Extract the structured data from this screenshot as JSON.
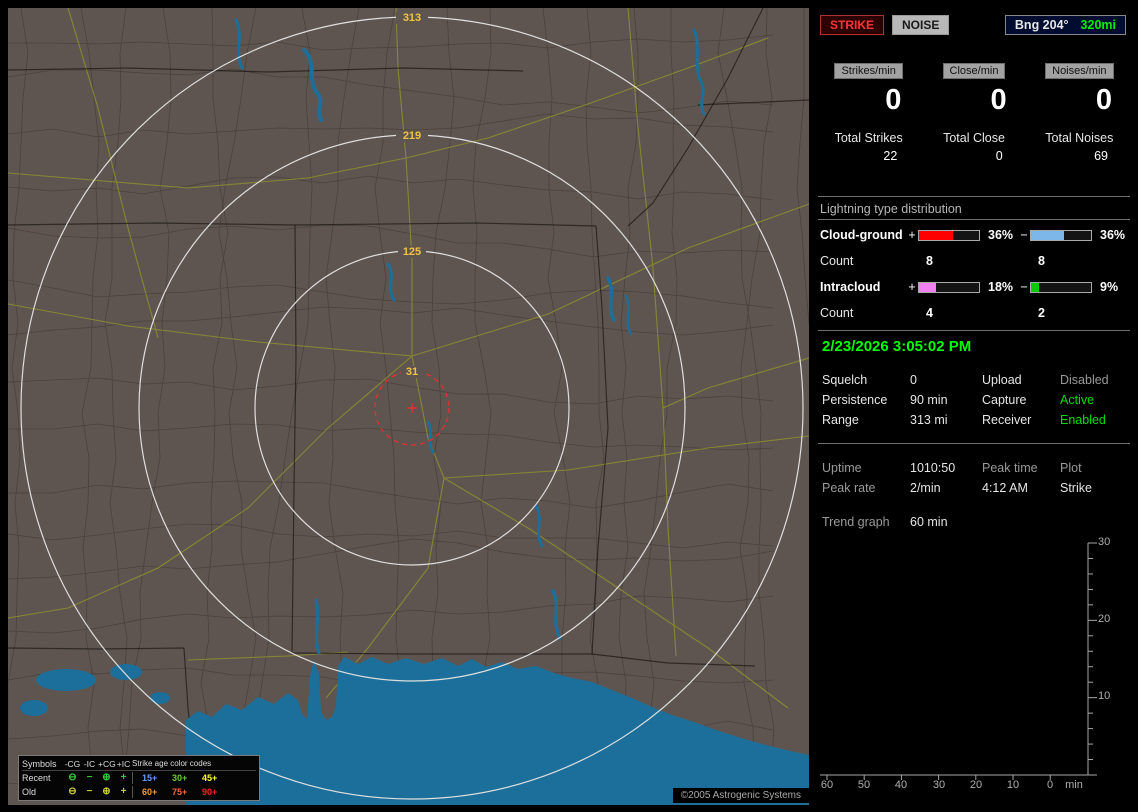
{
  "colors": {
    "accent_green": "#00ee00",
    "accent_red": "#ff3333",
    "map_land": "#5f5550",
    "map_water": "#1d6f9b",
    "map_road": "#8f8f2e",
    "ring_label": "#f0c244"
  },
  "map": {
    "ring_labels": [
      "313",
      "219",
      "125",
      "31"
    ],
    "copyright": "©2005 Astrogenic Systems",
    "legend": {
      "title_symbols": "Symbols",
      "columns": [
        "-CG",
        "-IC",
        "+CG",
        "+IC"
      ],
      "age_title": "Strike age color codes",
      "row_labels": [
        "Recent",
        "Old"
      ],
      "symbols": [
        "⊖",
        "−",
        "⊕",
        "+"
      ],
      "recent_color": "#33cc33",
      "old_color": "#cccc33",
      "ages": [
        "15+",
        "30+",
        "45+",
        "60+",
        "75+",
        "90+"
      ],
      "age_colors": [
        "#6699ff",
        "#66cc33",
        "#ffff33",
        "#ff9933",
        "#ff6633",
        "#ff2222"
      ]
    }
  },
  "panel": {
    "mode_buttons": [
      {
        "label": "STRIKE"
      },
      {
        "label": "NOISE"
      }
    ],
    "bearing_label": "Bng 204°",
    "bearing_range": "320mi",
    "rate_headers": [
      "Strikes/min",
      "Close/min",
      "Noises/min"
    ],
    "rate_values": [
      "0",
      "0",
      "0"
    ],
    "totals": [
      {
        "label": "Total Strikes",
        "value": "22"
      },
      {
        "label": "Total Close",
        "value": "0"
      },
      {
        "label": "Total Noises",
        "value": "69"
      }
    ],
    "distribution_title": "Lightning type distribution",
    "count_label": "Count",
    "distribution": [
      {
        "name": "Cloud-ground",
        "pos_sign": "+",
        "pos_pct": "36%",
        "pos_fill": "56%",
        "pos_color": "#ff0000",
        "neg_sign": "−",
        "neg_pct": "36%",
        "neg_fill": "55%",
        "neg_color": "#7db6e8",
        "pos_count": "8",
        "neg_count": "8"
      },
      {
        "name": "Intracloud",
        "pos_sign": "+",
        "pos_pct": "18%",
        "pos_fill": "28%",
        "pos_color": "#ef82ef",
        "neg_sign": "−",
        "neg_pct": "9%",
        "neg_fill": "14%",
        "neg_color": "#00cc00",
        "pos_count": "4",
        "neg_count": "2"
      }
    ],
    "status": {
      "datetime": "2/23/2026 3:05:02 PM",
      "rows": [
        {
          "label1": "Squelch",
          "value1": "0",
          "label2": "Upload",
          "value2": "Disabled",
          "value2_color": "#9a9a9a"
        },
        {
          "label1": "Persistence",
          "value1": "90 min",
          "label2": "Capture",
          "value2": "Active",
          "value2_color": "#00dd00"
        },
        {
          "label1": "Range",
          "value1": "313 mi",
          "label2": "Receiver",
          "value2": "Enabled",
          "value2_color": "#00dd00"
        }
      ]
    },
    "stats": {
      "uptime_label": "Uptime",
      "uptime_value": "1010:50",
      "peak_time_label": "Peak time",
      "peak_time_value": "4:12 AM",
      "plot_label": "Plot",
      "plot_value": "Strike",
      "peak_rate_label": "Peak rate",
      "peak_rate_value": "2/min",
      "trend_label": "Trend graph",
      "trend_value": "60 min"
    }
  },
  "chart_data": {
    "type": "line",
    "title": "Trend graph",
    "window_label": "60 min",
    "x_tick_labels": [
      "60",
      "50",
      "40",
      "30",
      "20",
      "10",
      "0"
    ],
    "x_unit": "min",
    "x_minutes_range": [
      60,
      0
    ],
    "y_tick_labels": [
      "30",
      "20",
      "10"
    ],
    "ylim": [
      0,
      30
    ],
    "grid": false,
    "legend": "none",
    "series": [
      {
        "name": "Strike",
        "points": []
      }
    ]
  }
}
